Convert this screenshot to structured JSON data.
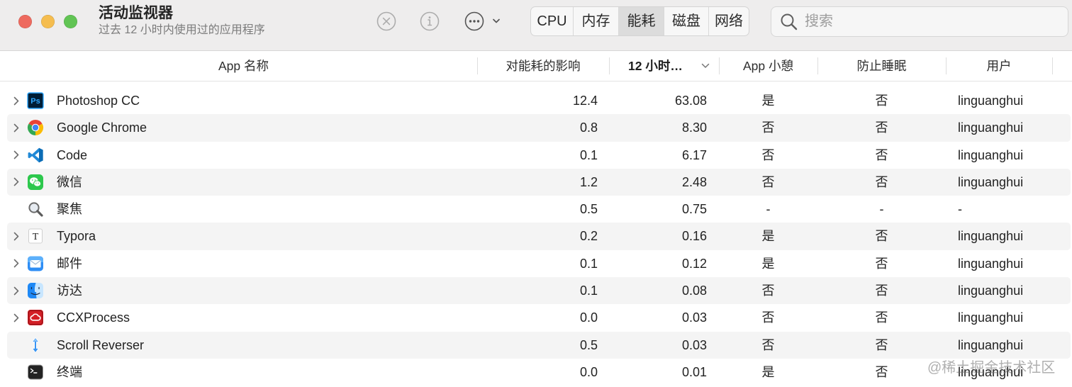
{
  "window": {
    "title": "活动监视器",
    "subtitle": "过去 12 小时内使用过的应用程序",
    "traffic_lights": {
      "close": "#ee6a5f",
      "minimize": "#f5bd4f",
      "zoom": "#61c454"
    }
  },
  "toolbar": {
    "buttons": [
      {
        "icon": "stop-process-icon",
        "enabled": false
      },
      {
        "icon": "info-icon",
        "enabled": false
      },
      {
        "icon": "ellipsis-circle-icon",
        "menu_icon": "chevron-down-icon",
        "enabled": true
      }
    ],
    "tabs": [
      {
        "label": "CPU",
        "selected": false
      },
      {
        "label": "内存",
        "selected": false
      },
      {
        "label": "能耗",
        "selected": true
      },
      {
        "label": "磁盘",
        "selected": false
      },
      {
        "label": "网络",
        "selected": false
      }
    ],
    "search": {
      "icon": "search-icon",
      "placeholder": "搜索",
      "value": ""
    }
  },
  "table": {
    "row_alt_color": "#f4f4f4",
    "columns": [
      {
        "label": "App 名称"
      },
      {
        "label": "对能耗的影响"
      },
      {
        "label": "12 小时…",
        "sorted": true,
        "sort_icon": "chevron-down-icon"
      },
      {
        "label": "App 小憩"
      },
      {
        "label": "防止睡眠"
      },
      {
        "label": "用户"
      }
    ],
    "rows": [
      {
        "name": "Photoshop CC",
        "icon": "photoshop-icon",
        "icon_glyph": "Ps",
        "expandable": true,
        "energy_impact": "12.4",
        "hours_12": "63.08",
        "app_nap": "是",
        "prevent_sleep": "否",
        "user": "linguanghui"
      },
      {
        "name": "Google Chrome",
        "icon": "chrome-icon",
        "expandable": true,
        "energy_impact": "0.8",
        "hours_12": "8.30",
        "app_nap": "否",
        "prevent_sleep": "否",
        "user": "linguanghui"
      },
      {
        "name": "Code",
        "icon": "vscode-icon",
        "expandable": true,
        "energy_impact": "0.1",
        "hours_12": "6.17",
        "app_nap": "否",
        "prevent_sleep": "否",
        "user": "linguanghui"
      },
      {
        "name": "微信",
        "icon": "wechat-icon",
        "expandable": true,
        "energy_impact": "1.2",
        "hours_12": "2.48",
        "app_nap": "否",
        "prevent_sleep": "否",
        "user": "linguanghui"
      },
      {
        "name": "聚焦",
        "icon": "spotlight-icon",
        "expandable": false,
        "energy_impact": "0.5",
        "hours_12": "0.75",
        "app_nap": "-",
        "prevent_sleep": "-",
        "user": "-"
      },
      {
        "name": "Typora",
        "icon": "typora-icon",
        "icon_glyph": "T",
        "expandable": true,
        "energy_impact": "0.2",
        "hours_12": "0.16",
        "app_nap": "是",
        "prevent_sleep": "否",
        "user": "linguanghui"
      },
      {
        "name": "邮件",
        "icon": "mail-icon",
        "expandable": true,
        "energy_impact": "0.1",
        "hours_12": "0.12",
        "app_nap": "是",
        "prevent_sleep": "否",
        "user": "linguanghui"
      },
      {
        "name": "访达",
        "icon": "finder-icon",
        "expandable": true,
        "energy_impact": "0.1",
        "hours_12": "0.08",
        "app_nap": "否",
        "prevent_sleep": "否",
        "user": "linguanghui"
      },
      {
        "name": "CCXProcess",
        "icon": "creative-cloud-icon",
        "expandable": true,
        "energy_impact": "0.0",
        "hours_12": "0.03",
        "app_nap": "否",
        "prevent_sleep": "否",
        "user": "linguanghui"
      },
      {
        "name": "Scroll Reverser",
        "icon": "scroll-reverser-icon",
        "expandable": false,
        "energy_impact": "0.5",
        "hours_12": "0.03",
        "app_nap": "否",
        "prevent_sleep": "否",
        "user": "linguanghui"
      },
      {
        "name": "终端",
        "icon": "terminal-icon",
        "expandable": false,
        "energy_impact": "0.0",
        "hours_12": "0.01",
        "app_nap": "是",
        "prevent_sleep": "否",
        "user": "linguanghui"
      }
    ]
  },
  "watermark": "@稀土掘金技术社区"
}
